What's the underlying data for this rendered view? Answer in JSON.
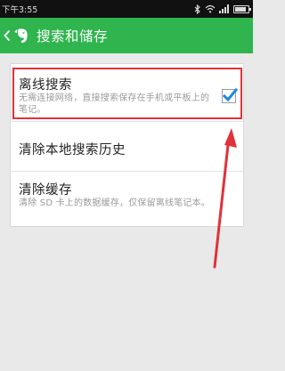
{
  "status_bar": {
    "time": "下午3:55"
  },
  "action_bar": {
    "title": "搜索和储存"
  },
  "settings": {
    "offline_search": {
      "title": "离线搜索",
      "subtitle": "无需连接网络，直接搜索保存在手机或平板上的笔记。",
      "checked": true
    },
    "clear_history": {
      "title": "清除本地搜索历史"
    },
    "clear_cache": {
      "title": "清除缓存",
      "subtitle": "清除 SD 卡上的数据缓存，仅保留离线笔记本。"
    }
  },
  "colors": {
    "action_bar": "#2fb44e",
    "annotation": "#e0323b",
    "checkbox_check": "#1e88e5"
  },
  "icons": [
    "back-arrow-icon",
    "evernote-elephant-icon",
    "bluetooth-icon",
    "wifi-icon",
    "signal-icon",
    "battery-icon"
  ]
}
